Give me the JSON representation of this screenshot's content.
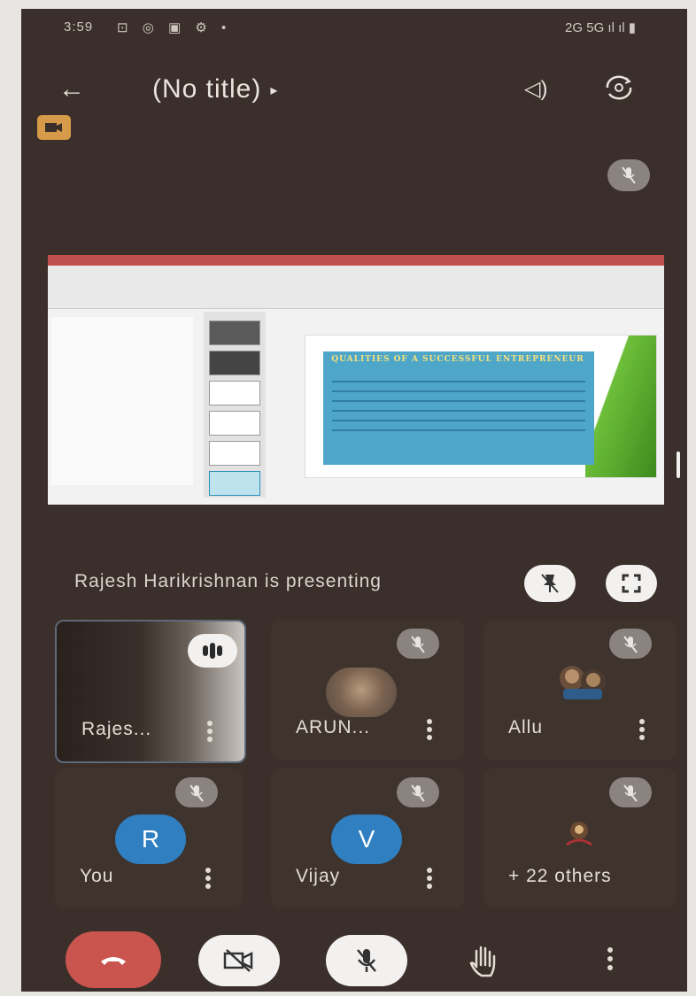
{
  "status_bar": {
    "time": "3:59",
    "icons": "⊡ ◎ ▣ ⚙ •",
    "right": "2G 5G ıl ıl ▮"
  },
  "header": {
    "back": "←",
    "title": "(No title)",
    "title_caret": "▸",
    "speaker": "◁)"
  },
  "slide": {
    "heading": "QUALITIES OF A SUCCESSFUL ENTREPRENEUR"
  },
  "presenting_text": "Rajesh Harikrishnan is presenting",
  "participants": [
    {
      "name": "Rajes...",
      "state": "speaking"
    },
    {
      "name": "ARUN...",
      "state": "muted"
    },
    {
      "name": "Allu",
      "state": "muted"
    },
    {
      "name": "You",
      "initial": "R",
      "state": "muted"
    },
    {
      "name": "Vijay",
      "initial": "V",
      "state": "muted"
    },
    {
      "name": "+ 22 others",
      "state": "muted"
    }
  ],
  "colors": {
    "background": "#3a2f2a",
    "end_call": "#c9554e",
    "avatar_blue": "#2f7fc1",
    "badge": "#d69a48"
  }
}
